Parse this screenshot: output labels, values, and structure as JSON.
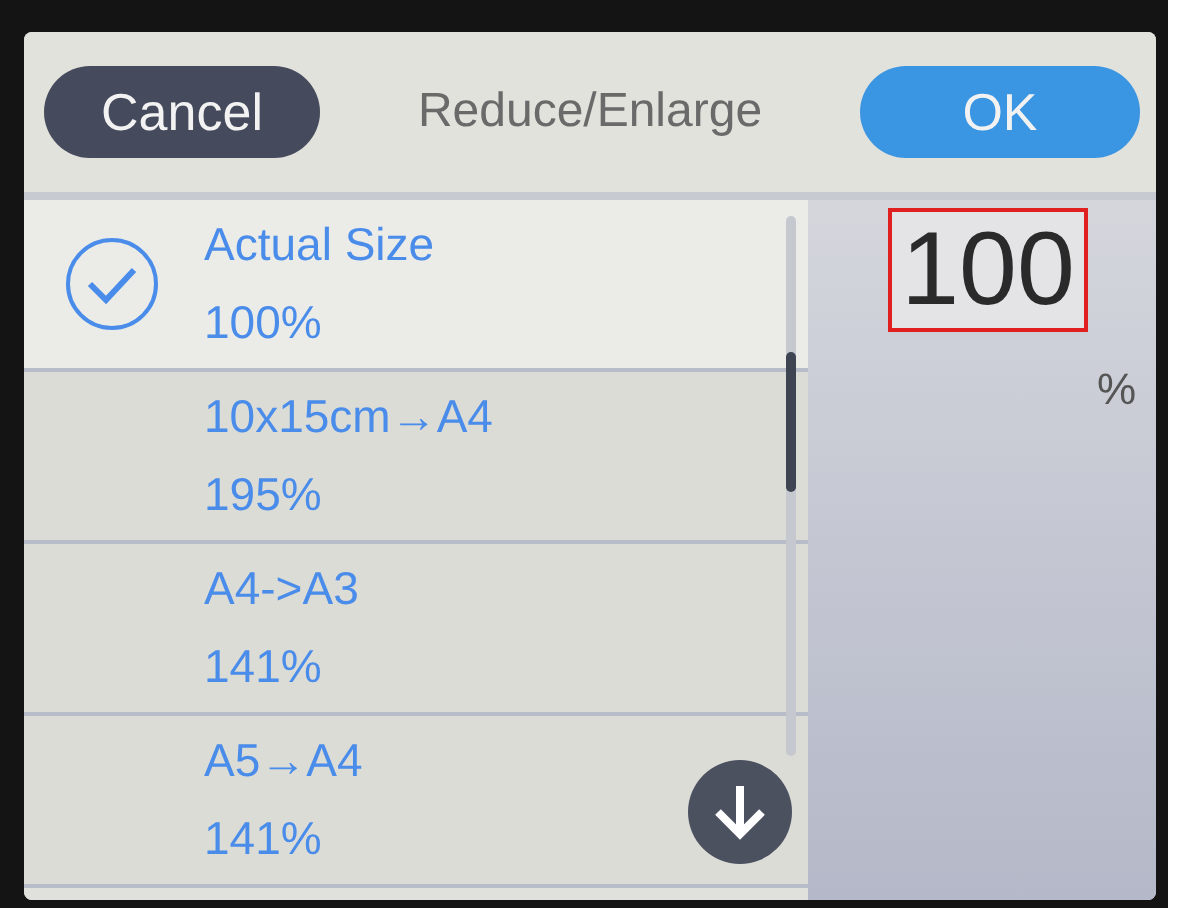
{
  "header": {
    "cancel_button": "Cancel",
    "title": "Reduce/Enlarge",
    "ok_button": "OK"
  },
  "options": [
    {
      "name": "Actual Size",
      "percent": "100%",
      "selected": true
    },
    {
      "name": "10x15cm→A4",
      "percent": "195%",
      "selected": false
    },
    {
      "name": "A4->A3",
      "percent": "141%",
      "selected": false
    },
    {
      "name": "A5→A4",
      "percent": "141%",
      "selected": false
    }
  ],
  "value": {
    "text": "100",
    "unit": "%",
    "highlighted": true
  }
}
